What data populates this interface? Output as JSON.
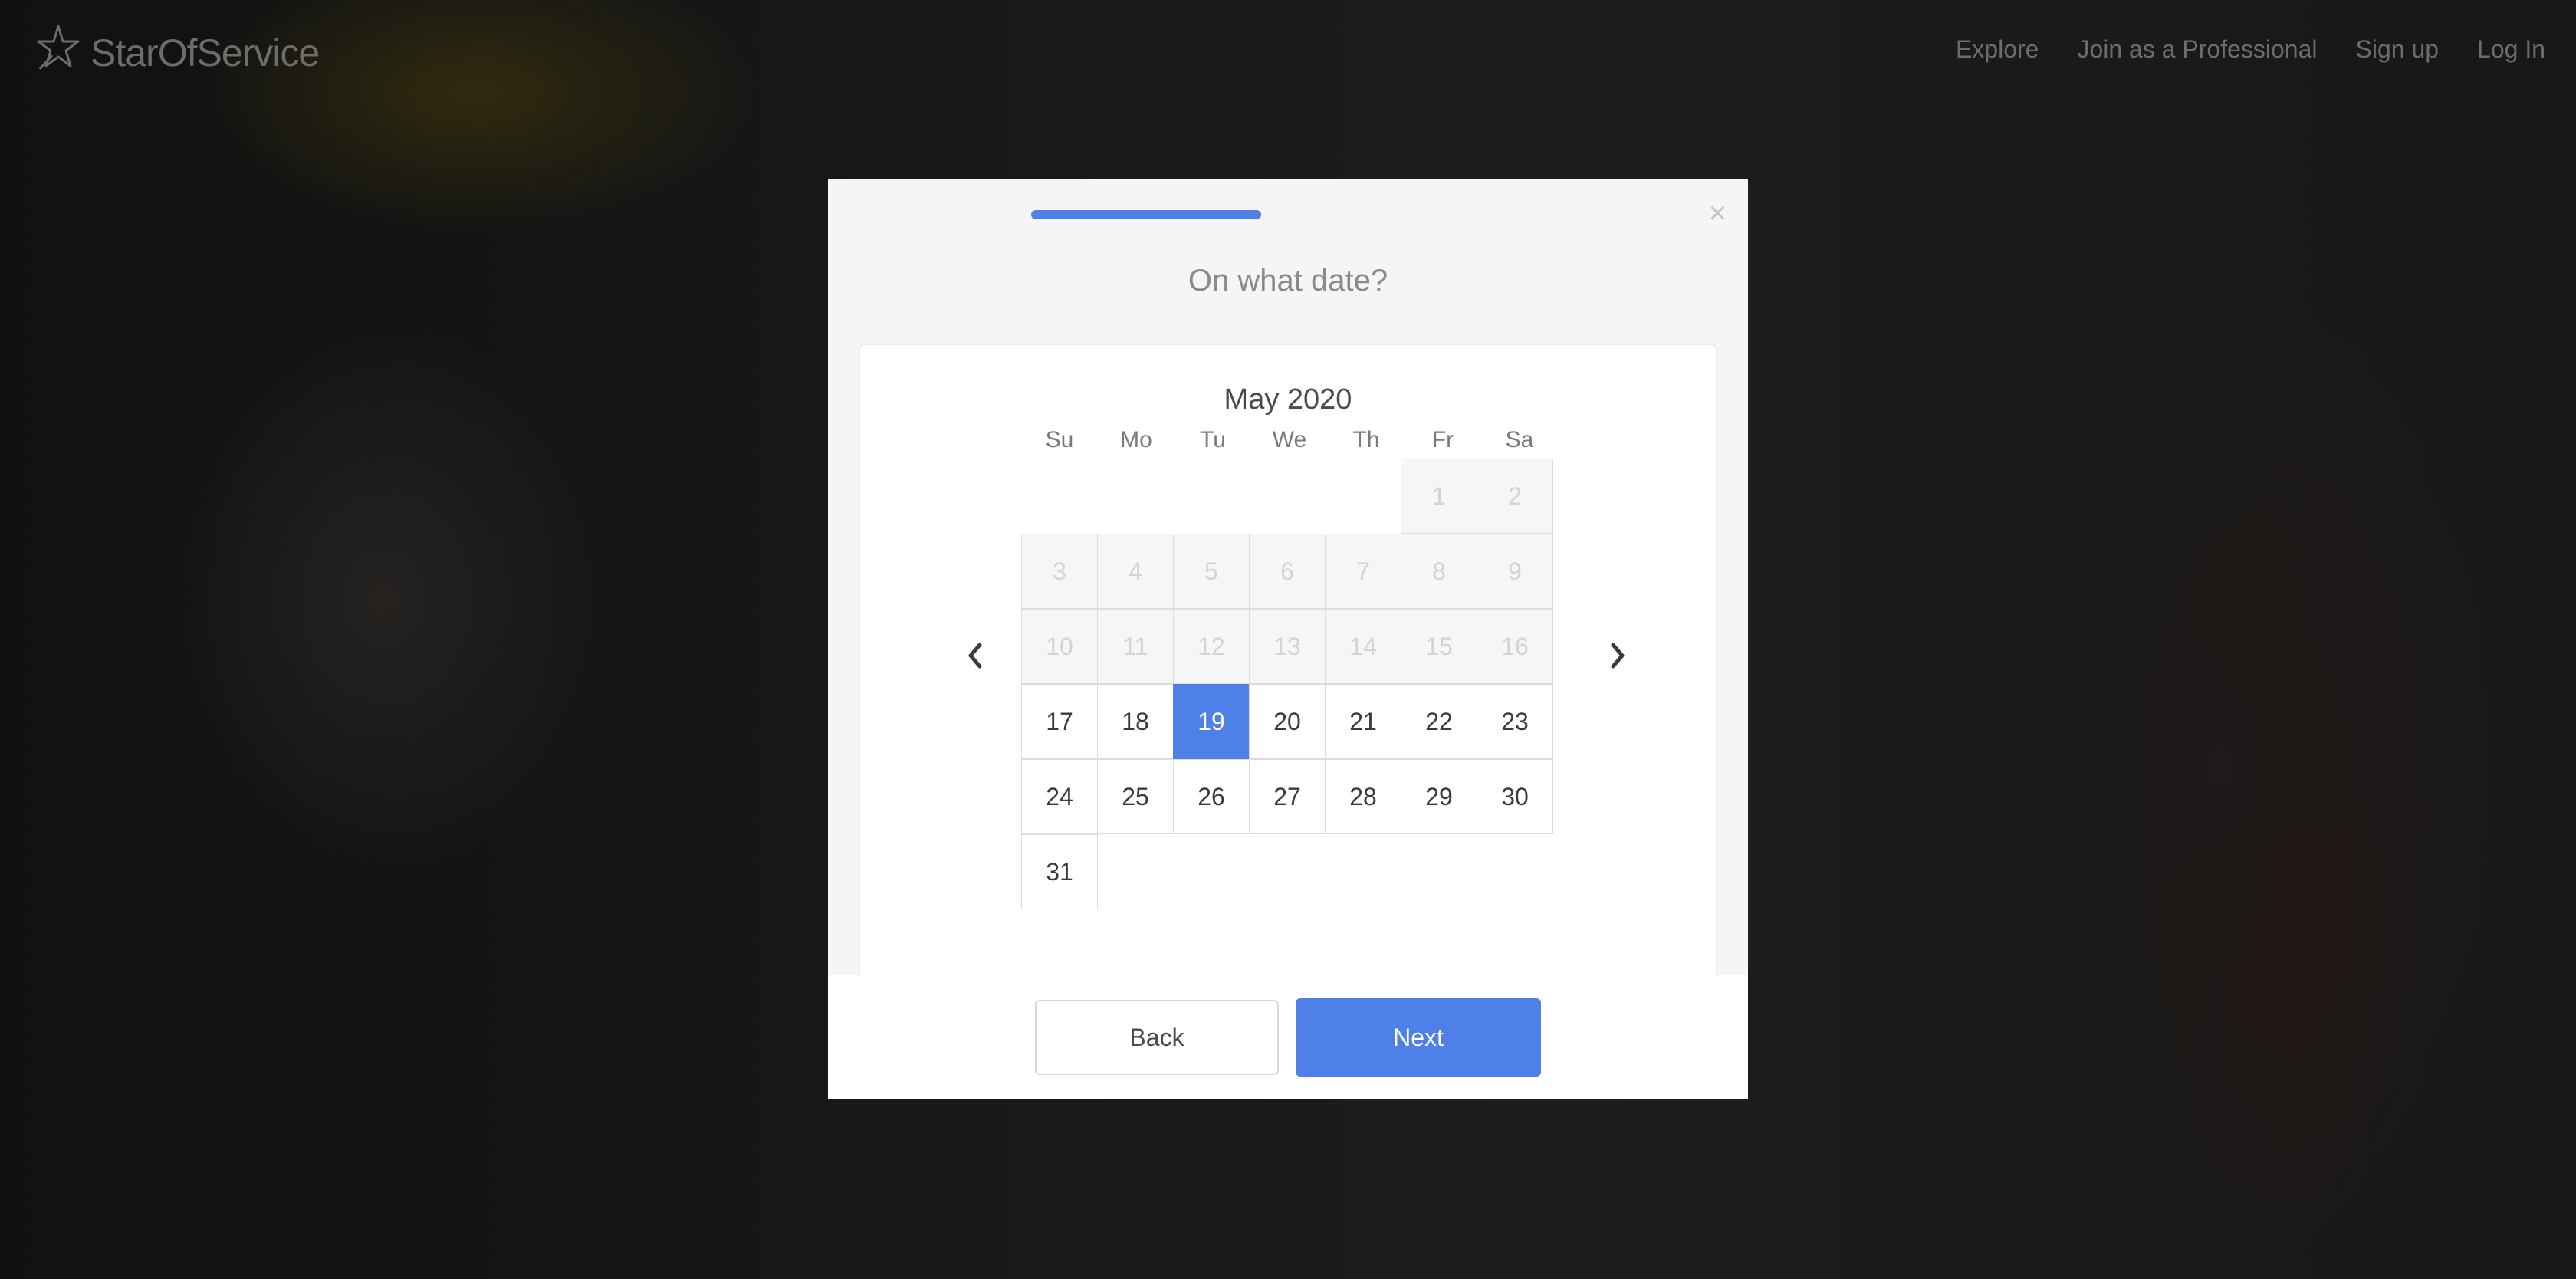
{
  "header": {
    "logo_text": "StarOfService",
    "nav": [
      {
        "label": "Explore"
      },
      {
        "label": "Join as a Professional"
      },
      {
        "label": "Sign up"
      },
      {
        "label": "Log In"
      }
    ]
  },
  "modal": {
    "close_label": "×",
    "title": "On what date?",
    "calendar": {
      "month_label": "May 2020",
      "weekdays": [
        "Su",
        "Mo",
        "Tu",
        "We",
        "Th",
        "Fr",
        "Sa"
      ],
      "weeks": [
        [
          null,
          null,
          null,
          null,
          null,
          {
            "d": "1",
            "state": "disabled"
          },
          {
            "d": "2",
            "state": "disabled"
          }
        ],
        [
          {
            "d": "3",
            "state": "disabled"
          },
          {
            "d": "4",
            "state": "disabled"
          },
          {
            "d": "5",
            "state": "disabled"
          },
          {
            "d": "6",
            "state": "disabled"
          },
          {
            "d": "7",
            "state": "disabled"
          },
          {
            "d": "8",
            "state": "disabled"
          },
          {
            "d": "9",
            "state": "disabled"
          }
        ],
        [
          {
            "d": "10",
            "state": "disabled"
          },
          {
            "d": "11",
            "state": "disabled"
          },
          {
            "d": "12",
            "state": "disabled"
          },
          {
            "d": "13",
            "state": "disabled"
          },
          {
            "d": "14",
            "state": "disabled"
          },
          {
            "d": "15",
            "state": "disabled"
          },
          {
            "d": "16",
            "state": "disabled"
          }
        ],
        [
          {
            "d": "17",
            "state": "active"
          },
          {
            "d": "18",
            "state": "active"
          },
          {
            "d": "19",
            "state": "selected"
          },
          {
            "d": "20",
            "state": "active"
          },
          {
            "d": "21",
            "state": "active"
          },
          {
            "d": "22",
            "state": "active"
          },
          {
            "d": "23",
            "state": "active"
          }
        ],
        [
          {
            "d": "24",
            "state": "active"
          },
          {
            "d": "25",
            "state": "active"
          },
          {
            "d": "26",
            "state": "active"
          },
          {
            "d": "27",
            "state": "active"
          },
          {
            "d": "28",
            "state": "active"
          },
          {
            "d": "29",
            "state": "active"
          },
          {
            "d": "30",
            "state": "active"
          }
        ],
        [
          {
            "d": "31",
            "state": "active"
          }
        ]
      ],
      "prev_icon": "chevron-left-icon",
      "next_icon": "chevron-right-icon"
    },
    "back_label": "Back",
    "next_label": "Next"
  },
  "colors": {
    "accent": "#4f80e8",
    "overlay": "#1a1a1a"
  }
}
